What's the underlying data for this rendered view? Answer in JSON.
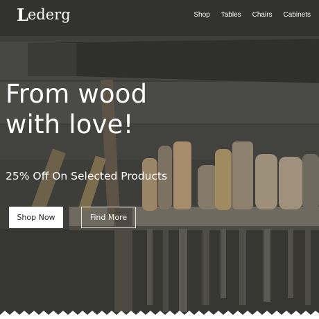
{
  "brand": {
    "initial": "L",
    "rest": "ederg"
  },
  "nav": {
    "items": [
      {
        "label": "Shop"
      },
      {
        "label": "Tables"
      },
      {
        "label": "Chairs"
      },
      {
        "label": "Cabinets"
      }
    ]
  },
  "hero": {
    "headline_line1": "From wood",
    "headline_line2": "with love!",
    "subheadline": "25% Off On Selected Products",
    "primary_button": "Shop Now",
    "secondary_button": "Find More",
    "background_image": "workshop tools on wooden shelf"
  },
  "colors": {
    "text": "#ffffff",
    "primary_button_bg": "#ffffff",
    "primary_button_text": "#222222",
    "navbar_overlay": "#2a2c2a"
  }
}
